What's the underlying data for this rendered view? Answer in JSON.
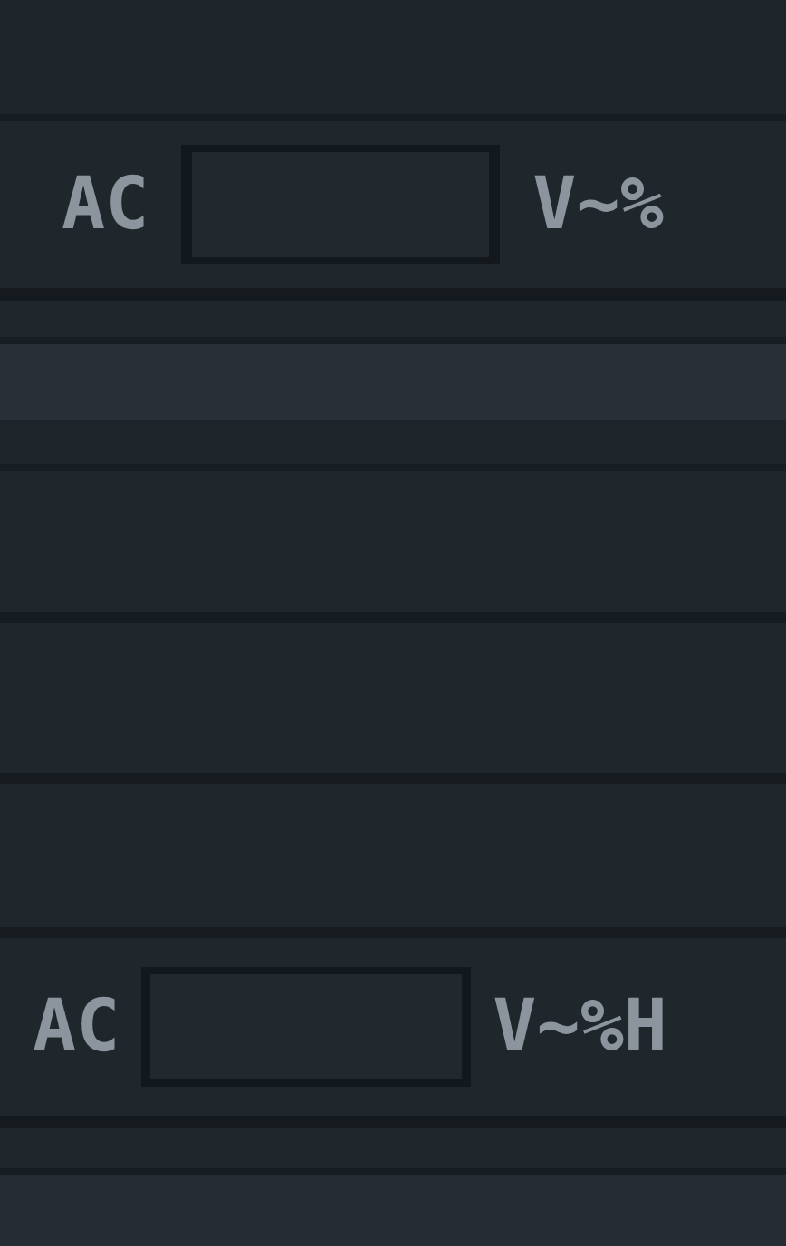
{
  "rows": [
    {
      "label": "AC",
      "value": "",
      "unit": "V~%"
    },
    {
      "label": "AC",
      "value": "",
      "unit": "V~%H"
    }
  ]
}
